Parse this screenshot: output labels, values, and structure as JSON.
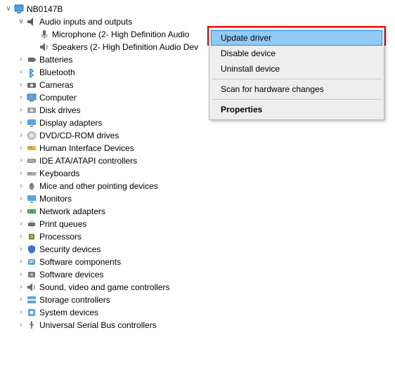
{
  "root": {
    "label": "NB0147B"
  },
  "audio_inputs": {
    "label": "Audio inputs and outputs",
    "children": [
      {
        "label": "Microphone (2- High Definition Audio"
      },
      {
        "label": "Speakers (2- High Definition Audio Dev"
      }
    ]
  },
  "categories": [
    {
      "key": "batteries",
      "label": "Batteries"
    },
    {
      "key": "bluetooth",
      "label": "Bluetooth"
    },
    {
      "key": "cameras",
      "label": "Cameras"
    },
    {
      "key": "computer",
      "label": "Computer"
    },
    {
      "key": "diskdrives",
      "label": "Disk drives"
    },
    {
      "key": "display",
      "label": "Display adapters"
    },
    {
      "key": "dvd",
      "label": "DVD/CD-ROM drives"
    },
    {
      "key": "hid",
      "label": "Human Interface Devices"
    },
    {
      "key": "ide",
      "label": "IDE ATA/ATAPI controllers"
    },
    {
      "key": "keyboards",
      "label": "Keyboards"
    },
    {
      "key": "mice",
      "label": "Mice and other pointing devices"
    },
    {
      "key": "monitors",
      "label": "Monitors"
    },
    {
      "key": "network",
      "label": "Network adapters"
    },
    {
      "key": "print",
      "label": "Print queues"
    },
    {
      "key": "processors",
      "label": "Processors"
    },
    {
      "key": "security",
      "label": "Security devices"
    },
    {
      "key": "swcomp",
      "label": "Software components"
    },
    {
      "key": "swdev",
      "label": "Software devices"
    },
    {
      "key": "sound",
      "label": "Sound, video and game controllers"
    },
    {
      "key": "storage",
      "label": "Storage controllers"
    },
    {
      "key": "system",
      "label": "System devices"
    },
    {
      "key": "usb",
      "label": "Universal Serial Bus controllers"
    }
  ],
  "context_menu": {
    "items": [
      {
        "label": "Update driver",
        "hover": true
      },
      {
        "label": "Disable device"
      },
      {
        "label": "Uninstall device"
      },
      {
        "sep": true
      },
      {
        "label": "Scan for hardware changes"
      },
      {
        "sep": true
      },
      {
        "label": "Properties",
        "bold": true
      }
    ]
  }
}
